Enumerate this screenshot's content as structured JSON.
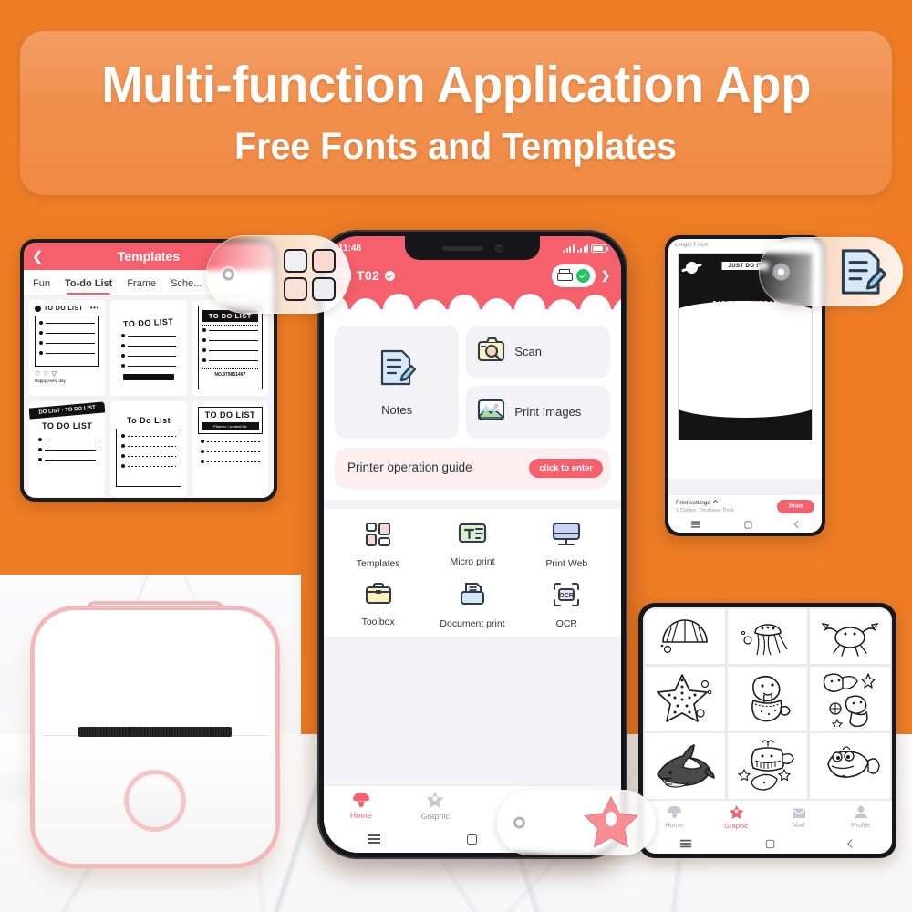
{
  "banner": {
    "title": "Multi-function Application App",
    "subtitle": "Free Fonts and Templates"
  },
  "colors": {
    "background_orange": "#ee7d26",
    "banner_orange": "#ef8339",
    "accent_pink": "#f4606c",
    "printer_pink": "#f4b8b8",
    "status_green": "#22c55e"
  },
  "templates_panel": {
    "back_icon": "chevron-left-icon",
    "title": "Templates",
    "tabs": [
      {
        "label": "Fun",
        "active": false
      },
      {
        "label": "To-do List",
        "active": true
      },
      {
        "label": "Frame",
        "active": false
      },
      {
        "label": "Sche...",
        "active": false
      }
    ],
    "cards": [
      {
        "title": "TO DO LIST",
        "style": "social-card",
        "footer": "Happy every day"
      },
      {
        "title": "TO DO LIST",
        "style": "tape-corners"
      },
      {
        "title": "TO DO LIST",
        "style": "ornate-ticket",
        "code": "NO.979851467"
      },
      {
        "title": "TO DO LIST",
        "style": "banner-tape"
      },
      {
        "title": "To Do List",
        "style": "cat-note"
      },
      {
        "title": "TO DO LIST",
        "style": "boxed-header",
        "subtitle": "Planner / content list"
      }
    ]
  },
  "main_phone": {
    "status_bar": {
      "time": "11:48",
      "signal_icon": "signal-bars-icon",
      "battery_icon": "battery-icon"
    },
    "top_bar": {
      "device_icon": "printer-device-icon",
      "device_name": "T02",
      "device_connected_icon": "check-circle-icon",
      "printer_icon": "printer-icon",
      "printer_status_icon": "check-circle-green-icon",
      "more_icon": "chevron-right-icon"
    },
    "quick_actions": [
      {
        "label": "Notes",
        "icon": "notes-edit-icon",
        "size": "large"
      },
      {
        "label": "Scan",
        "icon": "scan-camera-icon",
        "size": "small"
      },
      {
        "label": "Print Images",
        "icon": "image-picture-icon",
        "size": "small"
      }
    ],
    "guide": {
      "text": "Printer operation guide",
      "button_label": "click to enter"
    },
    "functions": [
      {
        "label": "Templates",
        "icon": "templates-grid-icon"
      },
      {
        "label": "Micro print",
        "icon": "text-print-icon"
      },
      {
        "label": "Print Web",
        "icon": "monitor-icon"
      },
      {
        "label": "Toolbox",
        "icon": "toolbox-icon"
      },
      {
        "label": "Document print",
        "icon": "document-print-icon"
      },
      {
        "label": "OCR",
        "icon": "ocr-scan-icon"
      }
    ],
    "tab_bar": [
      {
        "label": "Home",
        "icon": "home-mushroom-icon",
        "active": true
      },
      {
        "label": "Graphic",
        "icon": "graphic-star-icon",
        "active": false
      }
    ],
    "system_nav": [
      "menu-icon",
      "square-icon"
    ]
  },
  "preview_phone": {
    "length_label": "Length 7.4cm",
    "sticker_badge": "JUST DO IT",
    "art_title": "NICE DAY!",
    "print_settings": {
      "title": "Print settings",
      "caret_icon": "chevron-up-icon",
      "subtitle": "1 Copies, Thickness Thick",
      "button_label": "Print"
    },
    "system_nav": [
      "menu-icon",
      "square-icon",
      "back-icon"
    ]
  },
  "graphics_phone": {
    "stickers": [
      "scallop-shell",
      "jellyfish",
      "crab",
      "starfish",
      "walrus",
      "walrus-pair",
      "shark",
      "whale",
      "pufferfish"
    ],
    "tab_bar": [
      {
        "label": "Home",
        "icon": "home-mushroom-icon",
        "active": false
      },
      {
        "label": "Graphic",
        "icon": "graphic-star-icon",
        "active": true
      },
      {
        "label": "Mall",
        "icon": "mall-bag-icon",
        "active": false
      },
      {
        "label": "Profile",
        "icon": "profile-person-icon",
        "active": false
      }
    ],
    "system_nav": [
      "menu-icon",
      "square-icon",
      "back-icon"
    ]
  },
  "printer_device": {
    "name": "mini-thermal-printer",
    "button_icon": "power-button"
  },
  "floating_badges": [
    {
      "id": "templates-badge",
      "icon": "templates-grid-icon"
    },
    {
      "id": "notes-badge",
      "icon": "notes-edit-icon"
    },
    {
      "id": "graphic-star-badge",
      "icon": "star-icon"
    }
  ]
}
